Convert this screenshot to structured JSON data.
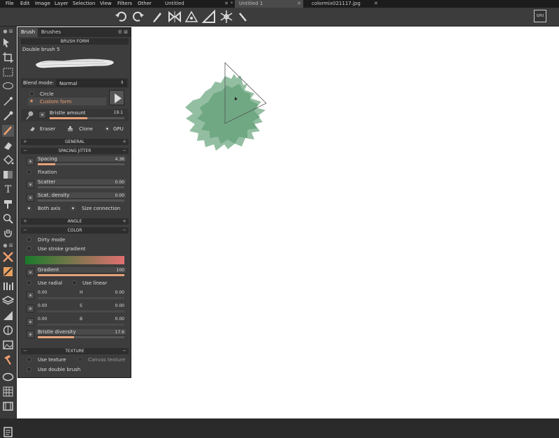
{
  "menu": {
    "items": [
      "File",
      "Edit",
      "Image",
      "Layer",
      "Selection",
      "View",
      "Filters",
      "Other"
    ],
    "tabs": [
      {
        "label": "Untitled",
        "active": false
      },
      {
        "label": "Untitled 1",
        "active": true
      },
      {
        "label": "colormix021117.jpg",
        "active": false
      }
    ]
  },
  "toolbar": {
    "icons": [
      "undo-icon",
      "redo-icon",
      "brush-icon",
      "symmetry-icon",
      "perspective-icon",
      "ruler-icon",
      "snowflake-icon",
      "pen-icon",
      "gpu-chip-icon"
    ],
    "chip_label": "GPU"
  },
  "panel": {
    "tabs": [
      "Brush",
      "Brushes"
    ],
    "brush_form_title": "BRUSH FORM",
    "brush_name": "Double brush 5",
    "blend_mode_label": "Blend mode:",
    "blend_mode_value": "Normal",
    "shape_circle": "Circle",
    "shape_custom": "Custom form",
    "bristle_amount_label": "Bristle amount",
    "bristle_amount_value": "19.1",
    "bristle_amount_fraction": 0.5,
    "eraser": "Eraser",
    "clone": "Clone",
    "gpu": "GPU",
    "general": "GENERAL",
    "spacing_jitter": "SPACING JITTER",
    "spacing_label": "Spacing",
    "spacing_value": "4.36",
    "spacing_fraction": 0.2,
    "fixation": "Fixation",
    "scatter_label": "Scatter",
    "scatter_value": "0.00",
    "scat_density_label": "Scat. density",
    "scat_density_value": "0.00",
    "both_axis": "Both axis",
    "size_connection": "Size connection",
    "angle": "ANGLE",
    "color": "COLOR",
    "dirty_mode": "Dirty mode",
    "use_stroke_gradient": "Use stroke gradient",
    "gradient_label": "Gradient",
    "gradient_value": "100",
    "gradient_fraction": 1.0,
    "use_radial": "Use radial",
    "use_linear": "Use linear",
    "h_label": "H",
    "h_left": "0.00",
    "h_right": "0.00",
    "s_label": "S",
    "s_left": "0.00",
    "s_right": "0.00",
    "b_label": "B",
    "b_left": "0.00",
    "b_right": "0.00",
    "bristle_diversity_label": "Bristle diversity",
    "bristle_diversity_value": "17.6",
    "bristle_diversity_fraction": 0.42,
    "texture": "TEXTURE",
    "use_texture": "Use texture",
    "canvas_texture": "Canvas texture",
    "use_double_brush": "Use double brush"
  },
  "colors": {
    "stroke_green": "#6fa882",
    "slider_fill": "#e6a27a",
    "gradient_start": "#1a7a2a",
    "gradient_end": "#e07070"
  }
}
